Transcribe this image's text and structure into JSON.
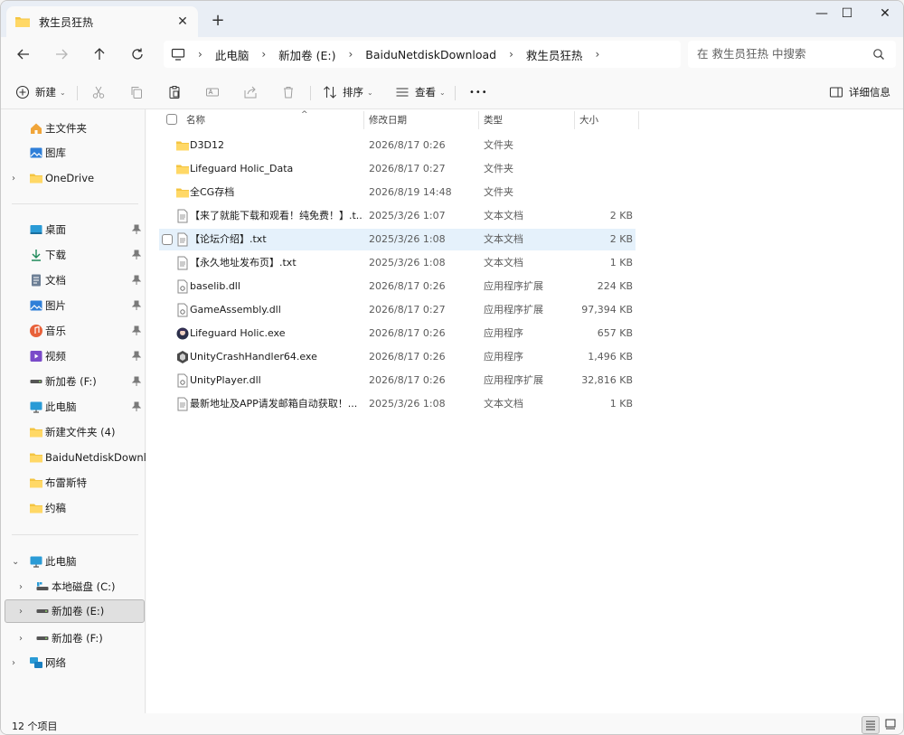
{
  "tab": {
    "title": "救生员狂热",
    "close": "✕",
    "new_tab": "+"
  },
  "window_controls": {
    "minimize": "—",
    "maximize": "☐",
    "close": "✕"
  },
  "breadcrumb": [
    "此电脑",
    "新加卷 (E:)",
    "BaiduNetdiskDownload",
    "救生员狂热"
  ],
  "breadcrumb_sep": "›",
  "search": {
    "placeholder": "在 救生员狂热 中搜索"
  },
  "commands": {
    "new_label": "新建",
    "sort_label": "排序",
    "view_label": "查看",
    "more": "•••",
    "details_label": "详细信息"
  },
  "sidebar": {
    "home": "主文件夹",
    "gallery": "图库",
    "onedrive": "OneDrive",
    "quick": [
      {
        "label": "桌面",
        "icon": "desktop-icon"
      },
      {
        "label": "下载",
        "icon": "download-icon"
      },
      {
        "label": "文档",
        "icon": "document-icon"
      },
      {
        "label": "图片",
        "icon": "pictures-icon"
      },
      {
        "label": "音乐",
        "icon": "music-icon"
      },
      {
        "label": "视频",
        "icon": "video-icon"
      },
      {
        "label": "新加卷 (F:)",
        "icon": "drive-icon"
      },
      {
        "label": "此电脑",
        "icon": "computer-icon"
      },
      {
        "label": "新建文件夹 (4)",
        "icon": "folder-icon"
      },
      {
        "label": "BaiduNetdiskDownload",
        "icon": "folder-icon"
      },
      {
        "label": "布雷斯特",
        "icon": "folder-icon"
      },
      {
        "label": "约稿",
        "icon": "folder-icon"
      }
    ],
    "this_pc": "此电脑",
    "drives": [
      "本地磁盘 (C:)",
      "新加卷 (E:)",
      "新加卷 (F:)"
    ],
    "network": "网络"
  },
  "columns": {
    "name": "名称",
    "date": "修改日期",
    "type": "类型",
    "size": "大小"
  },
  "files": [
    {
      "name": "D3D12",
      "date": "2026/8/17 0:26",
      "type": "文件夹",
      "size": "",
      "icon": "folder-icon"
    },
    {
      "name": "Lifeguard Holic_Data",
      "date": "2026/8/17 0:27",
      "type": "文件夹",
      "size": "",
      "icon": "folder-icon"
    },
    {
      "name": "全CG存档",
      "date": "2026/8/19 14:48",
      "type": "文件夹",
      "size": "",
      "icon": "folder-icon"
    },
    {
      "name": "【来了就能下载和观看！纯免费！】.t...",
      "date": "2025/3/26 1:07",
      "type": "文本文档",
      "size": "2 KB",
      "icon": "text-file-icon"
    },
    {
      "name": "【论坛介绍】.txt",
      "date": "2025/3/26 1:08",
      "type": "文本文档",
      "size": "2 KB",
      "icon": "text-file-icon"
    },
    {
      "name": "【永久地址发布页】.txt",
      "date": "2025/3/26 1:08",
      "type": "文本文档",
      "size": "1 KB",
      "icon": "text-file-icon"
    },
    {
      "name": "baselib.dll",
      "date": "2026/8/17 0:26",
      "type": "应用程序扩展",
      "size": "224 KB",
      "icon": "dll-file-icon"
    },
    {
      "name": "GameAssembly.dll",
      "date": "2026/8/17 0:27",
      "type": "应用程序扩展",
      "size": "97,394 KB",
      "icon": "dll-file-icon"
    },
    {
      "name": "Lifeguard Holic.exe",
      "date": "2026/8/17 0:26",
      "type": "应用程序",
      "size": "657 KB",
      "icon": "game-exe-icon"
    },
    {
      "name": "UnityCrashHandler64.exe",
      "date": "2026/8/17 0:26",
      "type": "应用程序",
      "size": "1,496 KB",
      "icon": "unity-exe-icon"
    },
    {
      "name": "UnityPlayer.dll",
      "date": "2026/8/17 0:26",
      "type": "应用程序扩展",
      "size": "32,816 KB",
      "icon": "dll-file-icon"
    },
    {
      "name": "最新地址及APP请发邮箱自动获取！...",
      "date": "2025/3/26 1:08",
      "type": "文本文档",
      "size": "1 KB",
      "icon": "text-file-icon"
    }
  ],
  "status": {
    "count": "12 个项目"
  },
  "colors": {
    "folder": "#f4c542",
    "accent": "#0067c0",
    "hover_row": "#e5f1fb",
    "selected_nav": "#e0e0e0"
  }
}
